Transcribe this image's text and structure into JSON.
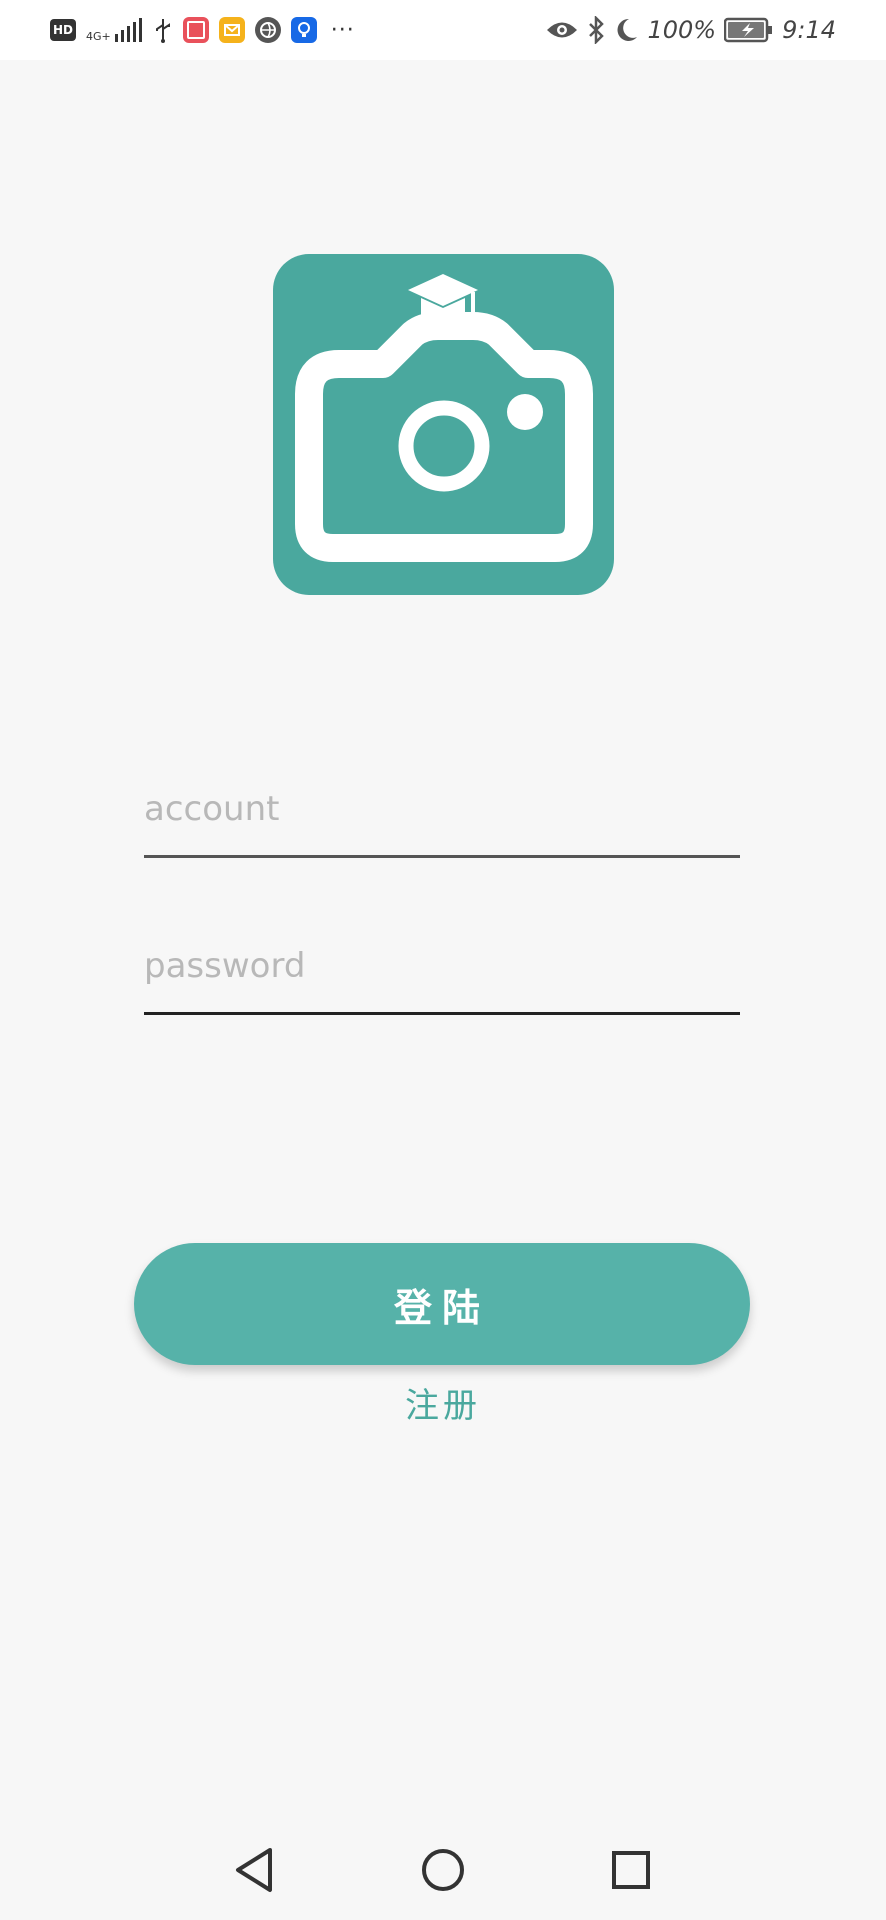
{
  "status_bar": {
    "hd_label": "HD",
    "network_label": "4G+",
    "battery_percent": "100%",
    "time": "9:14",
    "more_indicator": "···",
    "left_icons": [
      "hd-icon",
      "signal-icon",
      "usb-icon",
      "book-app-icon",
      "mail-app-icon",
      "browser-app-icon",
      "bulb-app-icon"
    ],
    "right_icons": [
      "eye-icon",
      "bluetooth-icon",
      "moon-icon",
      "battery-icon"
    ]
  },
  "logo": {
    "icon": "camera-graduation-cap-icon",
    "color": "#4aa89e"
  },
  "form": {
    "account_placeholder": "account",
    "account_value": "",
    "password_placeholder": "password",
    "password_value": ""
  },
  "actions": {
    "login_label": "登陆",
    "register_label": "注册"
  },
  "nav_bar": {
    "back_icon": "back-triangle-icon",
    "home_icon": "home-circle-icon",
    "recent_icon": "recent-square-icon"
  },
  "colors": {
    "accent": "#56b2a9",
    "accent_dark": "#4aa89e",
    "background": "#f7f7f7"
  }
}
